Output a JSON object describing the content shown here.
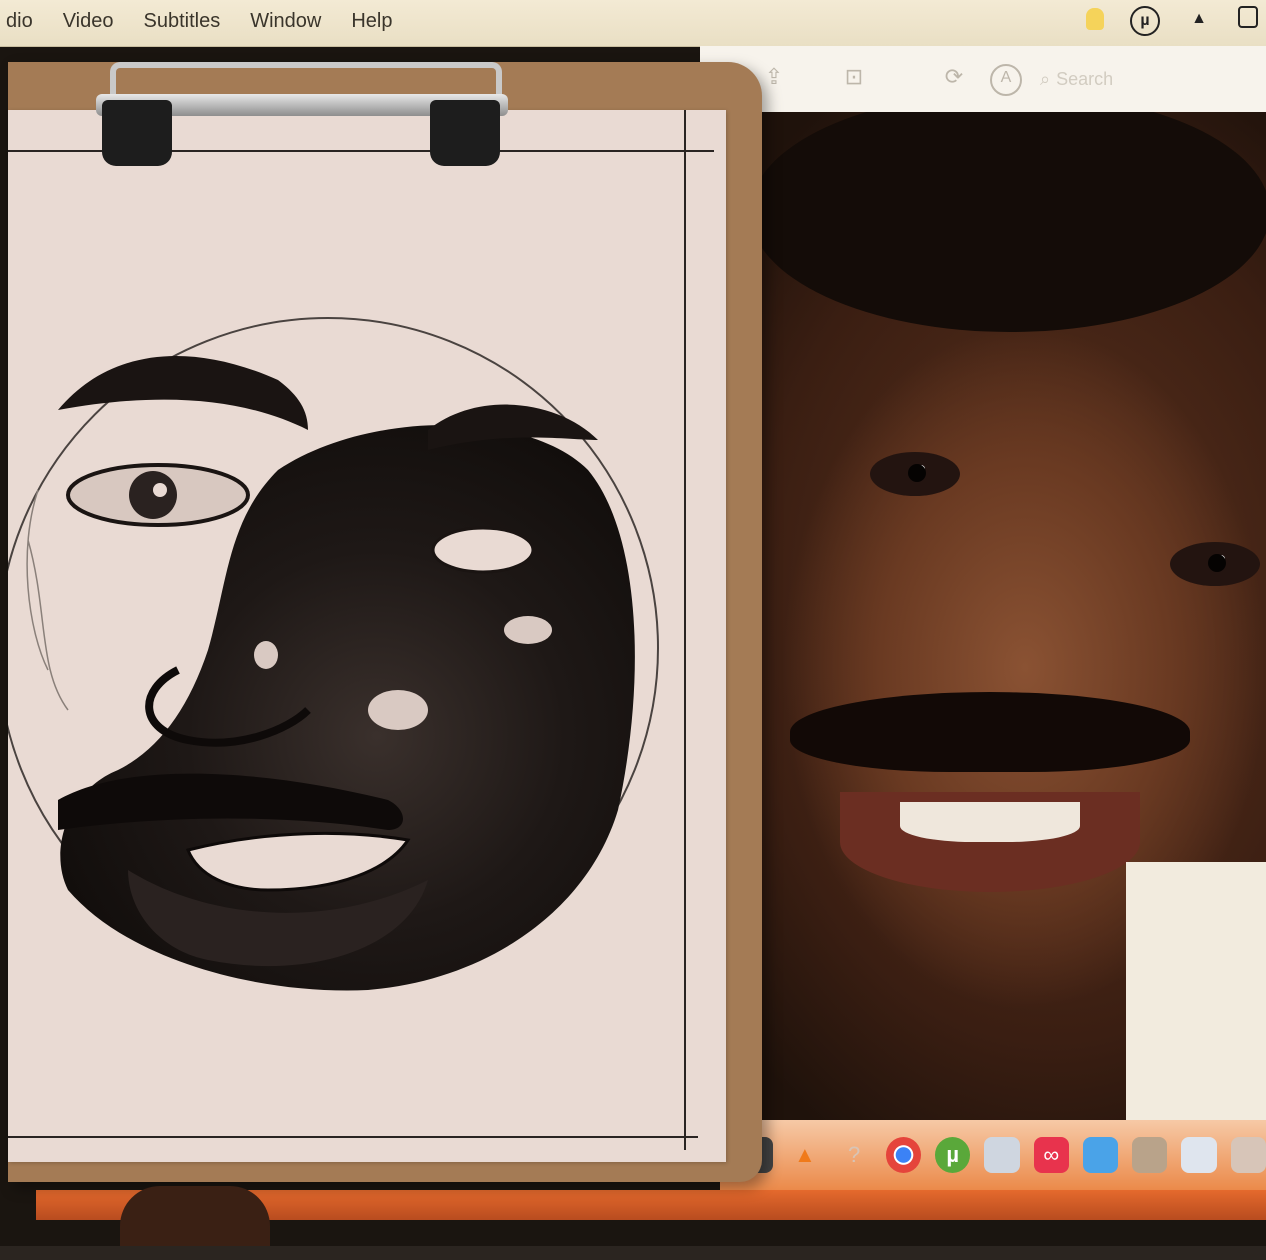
{
  "menubar": {
    "items": [
      "dio",
      "Video",
      "Subtitles",
      "Window",
      "Help"
    ]
  },
  "toolbar": {
    "search_placeholder": "Search"
  },
  "tray_icons": [
    "cursor-icon",
    "utorrent-icon",
    "vlc-icon",
    "image-icon"
  ],
  "toolbar_icons": [
    "share-icon",
    "crop-icon",
    "rotate-icon",
    "markup-icon",
    "search-icon"
  ],
  "dock_icons": [
    "downloads-icon",
    "vlc-icon",
    "help-icon",
    "chrome-icon",
    "utorrent-icon",
    "preview-icon",
    "creative-cloud-icon",
    "folder-icon",
    "photos-icon",
    "calendar-icon",
    "image-icon"
  ],
  "colors": {
    "menubar": "#f3ead4",
    "dock": "#eb8a4a",
    "clipboard": "#a47b55",
    "paper": "#e9dad3",
    "ink": "#1a1412"
  }
}
